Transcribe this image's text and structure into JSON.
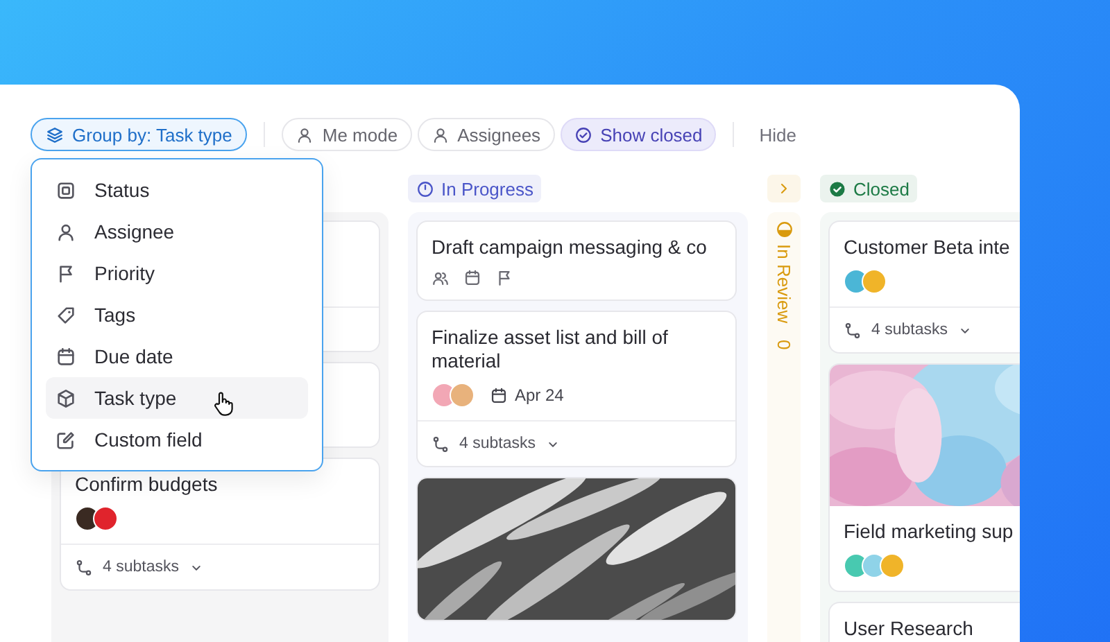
{
  "toolbar": {
    "group_by": {
      "label": "Group by: Task type",
      "open": true
    },
    "chips": [
      {
        "label": "Me mode",
        "selected": false
      },
      {
        "label": "Assignees",
        "selected": false
      },
      {
        "label": "Show closed",
        "selected": true
      }
    ],
    "hide": "Hide"
  },
  "group_menu": {
    "items": [
      {
        "label": "Status",
        "selected": false
      },
      {
        "label": "Assignee",
        "selected": false
      },
      {
        "label": "Priority",
        "selected": false
      },
      {
        "label": "Tags",
        "selected": false
      },
      {
        "label": "Due date",
        "selected": false
      },
      {
        "label": "Task type",
        "selected": true
      },
      {
        "label": "Custom field",
        "selected": false
      }
    ]
  },
  "columns": [
    {
      "kind": "list",
      "cards": [
        {
          "kind": "covered",
          "footer": true
        },
        {
          "kind": "covered",
          "footer": false
        },
        {
          "kind": "task",
          "title": "Confirm budgets",
          "avatars": [
            {
              "color": "#3a2a22"
            },
            {
              "color": "#e0242c"
            }
          ],
          "subtasks": "4 subtasks"
        }
      ]
    },
    {
      "kind": "list",
      "title": "In Progress",
      "color": "#4a55c8",
      "cards": [
        {
          "kind": "task",
          "title": "Draft campaign messaging & co",
          "empty_fields": true
        },
        {
          "kind": "task",
          "title": "Finalize asset list and bill of material",
          "avatars": [
            {
              "color": "#f2a7b5"
            },
            {
              "color": "#e8b27c"
            }
          ],
          "date": "Apr 24",
          "subtasks": "4 subtasks"
        },
        {
          "kind": "cover"
        }
      ]
    },
    {
      "kind": "collapsed",
      "title": "In Review",
      "count": "0",
      "color": "#d99a0e"
    },
    {
      "kind": "list",
      "title": "Closed",
      "color": "#1c7a45",
      "cards": [
        {
          "kind": "task",
          "title": "Customer Beta inte",
          "avatars": [
            {
              "color": "#4bb6d6"
            },
            {
              "color": "#f0b429"
            }
          ],
          "subtasks": "4 subtasks"
        },
        {
          "kind": "cover",
          "title": "Field marketing sup",
          "avatars": [
            {
              "color": "#48c9b0"
            },
            {
              "color": "#8fd3e8"
            },
            {
              "color": "#f0b429"
            }
          ]
        },
        {
          "kind": "task",
          "title": "User Research"
        }
      ]
    }
  ]
}
